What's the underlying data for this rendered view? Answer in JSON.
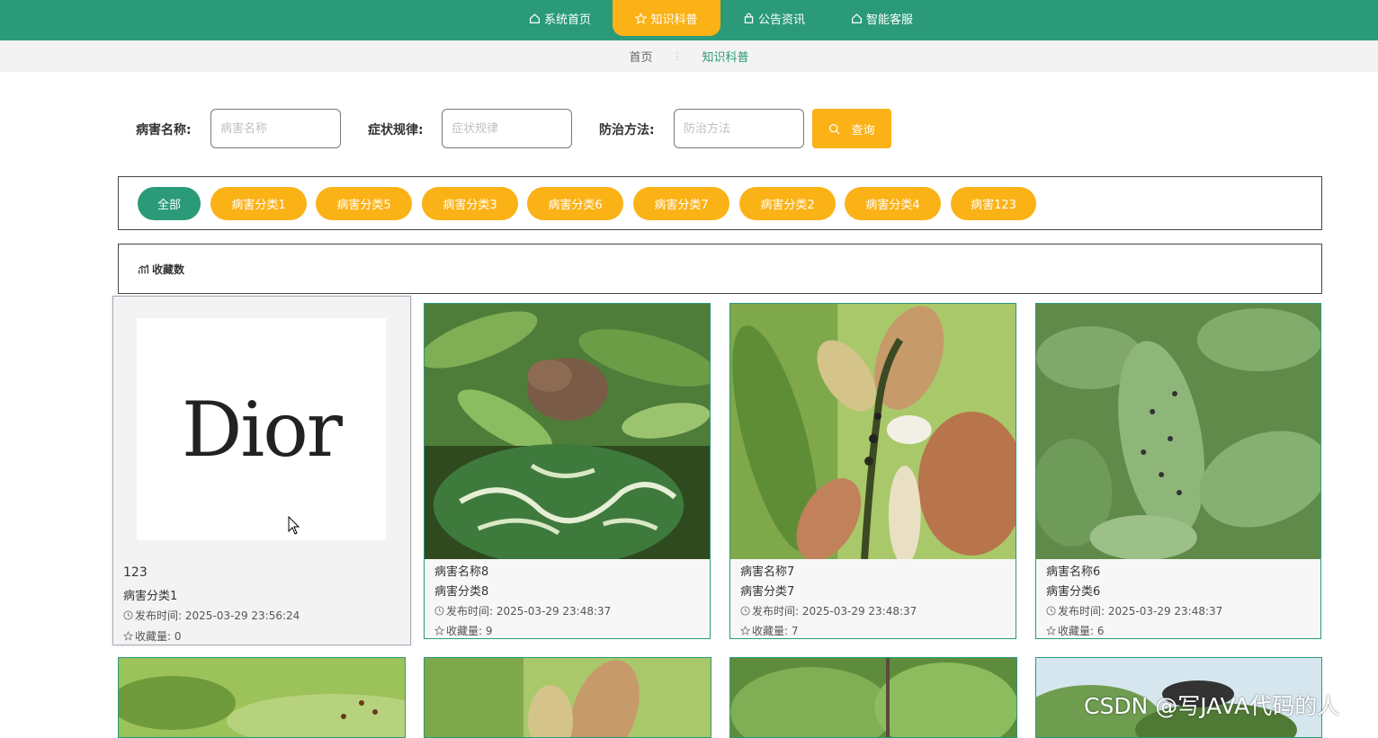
{
  "nav": {
    "items": [
      {
        "label": "系统首页",
        "icon": "home-icon",
        "active": false
      },
      {
        "label": "知识科普",
        "icon": "star-icon",
        "active": true
      },
      {
        "label": "公告资讯",
        "icon": "bag-icon",
        "active": false
      },
      {
        "label": "智能客服",
        "icon": "home-icon",
        "active": false
      }
    ]
  },
  "breadcrumb": {
    "home": "首页",
    "separator": "⋮",
    "current": "知识科普"
  },
  "search": {
    "name_label": "病害名称:",
    "name_placeholder": "病害名称",
    "symptom_label": "症状规律:",
    "symptom_placeholder": "症状规律",
    "method_label": "防治方法:",
    "method_placeholder": "防治方法",
    "button_label": "查询"
  },
  "categories": [
    "全部",
    "病害分类1",
    "病害分类5",
    "病害分类3",
    "病害分类6",
    "病害分类7",
    "病害分类2",
    "病害分类4",
    "病害123"
  ],
  "sort": {
    "label": "收藏数",
    "icon": "chart-icon"
  },
  "cards": [
    {
      "name": "123",
      "category": "病害分类1",
      "time": "发布时间:  2025-03-29 23:56:24",
      "fav": "收藏量:  0",
      "logo": "Dior"
    },
    {
      "name": "病害名称8",
      "category": "病害分类8",
      "time": "发布时间:  2025-03-29 23:48:37",
      "fav": "收藏量:  9"
    },
    {
      "name": "病害名称7",
      "category": "病害分类7",
      "time": "发布时间:  2025-03-29 23:48:37",
      "fav": "收藏量:  7"
    },
    {
      "name": "病害名称6",
      "category": "病害分类6",
      "time": "发布时间:  2025-03-29 23:48:37",
      "fav": "收藏量:  6"
    }
  ],
  "watermark": "CSDN @写JAVA代码的人",
  "colors": {
    "primary": "#2b9a78",
    "accent": "#fbb216"
  }
}
